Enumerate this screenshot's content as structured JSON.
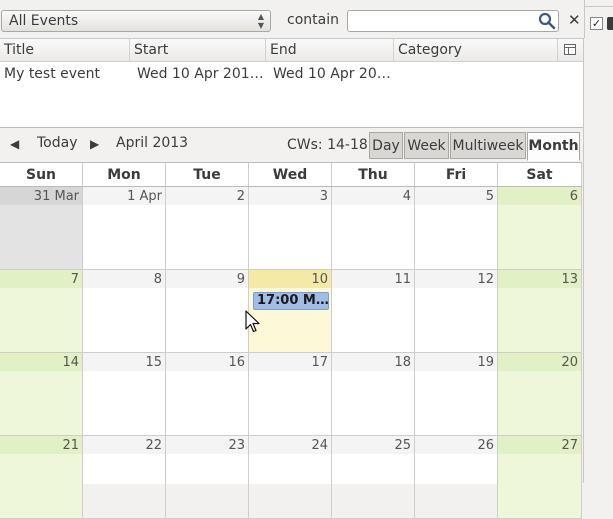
{
  "filter": {
    "selected": "All Events",
    "contain_label": "contain",
    "search_value": "",
    "sidebar_checkbox": "✓"
  },
  "list": {
    "columns": [
      "Title",
      "Start",
      "End",
      "Category"
    ],
    "rows": [
      {
        "title": "My test event",
        "start": "Wed 10 Apr 201…",
        "end": "Wed 10 Apr 20…",
        "category": ""
      }
    ]
  },
  "nav": {
    "prev": "◀",
    "today": "Today",
    "next": "▶",
    "month": "April 2013",
    "cw": "CWs: 14-18",
    "views": [
      "Day",
      "Week",
      "Multiweek",
      "Month"
    ],
    "active_view": "Month"
  },
  "calendar": {
    "weekdays": [
      "Sun",
      "Mon",
      "Tue",
      "Wed",
      "Thu",
      "Fri",
      "Sat"
    ],
    "weeks": [
      [
        "31 Mar",
        "1 Apr",
        "2",
        "3",
        "4",
        "5",
        "6"
      ],
      [
        "7",
        "8",
        "9",
        "10",
        "11",
        "12",
        "13"
      ],
      [
        "14",
        "15",
        "16",
        "17",
        "18",
        "19",
        "20"
      ],
      [
        "21",
        "22",
        "23",
        "24",
        "25",
        "26",
        "27"
      ]
    ],
    "today": "10",
    "event": {
      "day": "10",
      "label": "17:00 M…"
    }
  },
  "colors": {
    "weekend": "#eef7d9",
    "other_month": "#e3e3e3",
    "today": "#fcf8d8",
    "today_band": "#f5e9a8",
    "event": "#a1bde6"
  }
}
